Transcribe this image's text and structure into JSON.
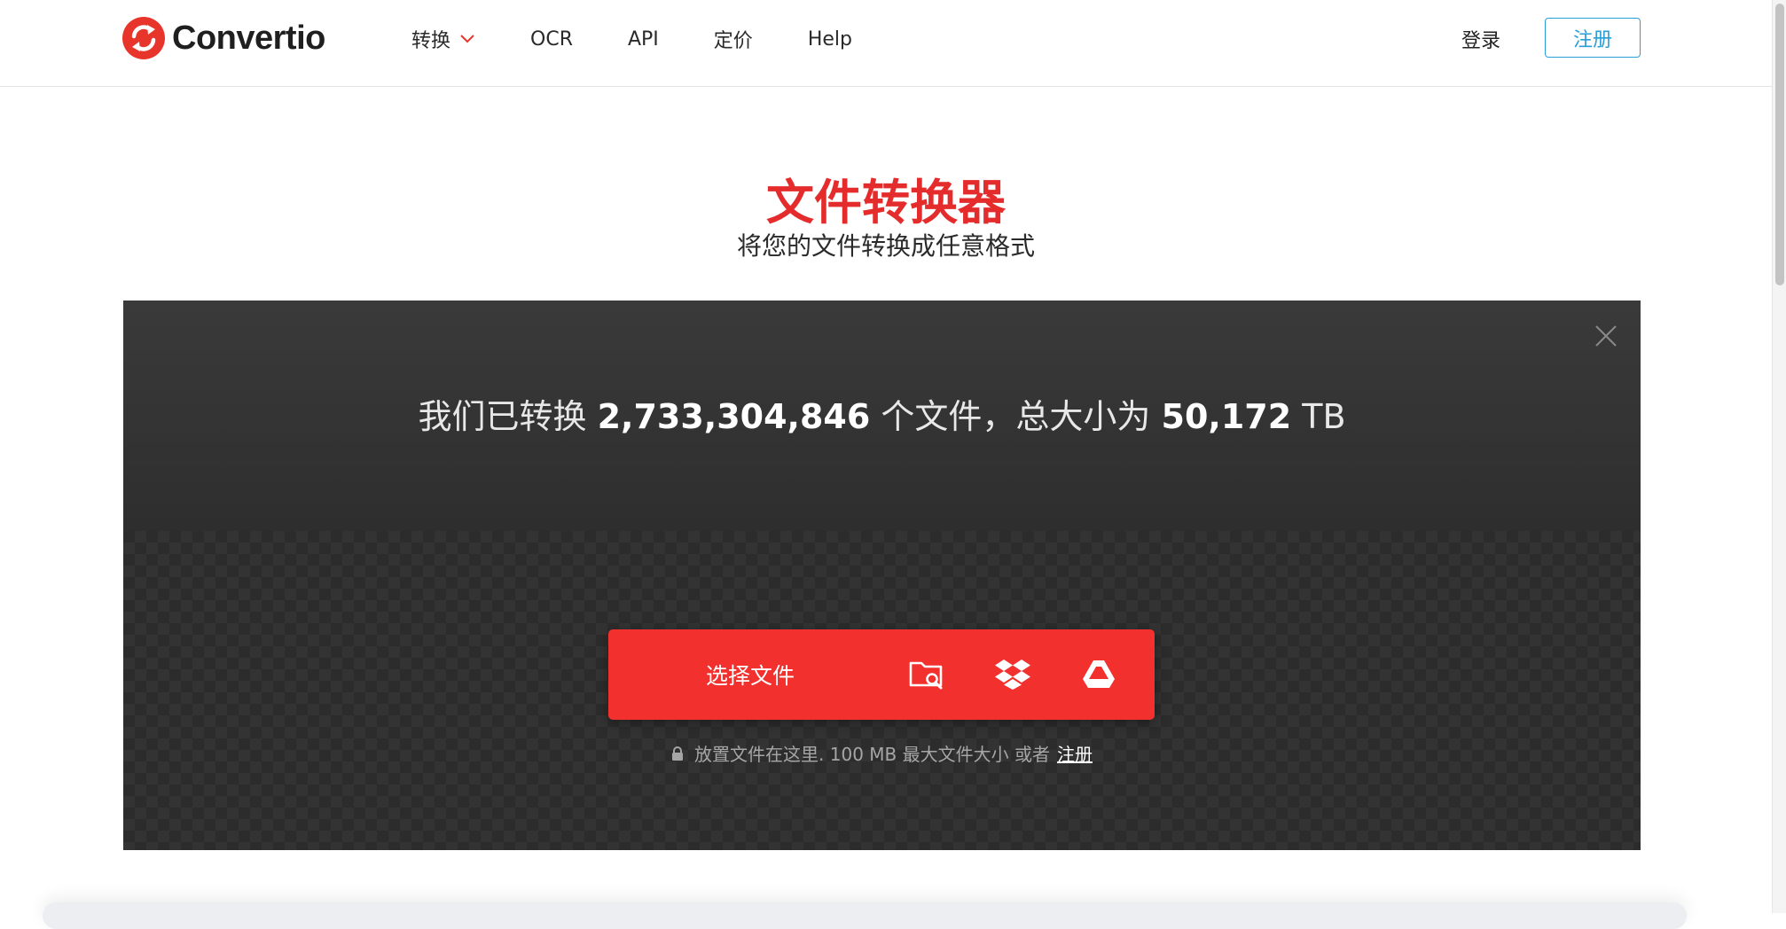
{
  "header": {
    "logo_text": "Convertio",
    "nav": [
      {
        "label": "转换",
        "has_dropdown": true
      },
      {
        "label": "OCR"
      },
      {
        "label": "API"
      },
      {
        "label": "定价"
      },
      {
        "label": "Help"
      }
    ],
    "login_label": "登录",
    "register_label": "注册"
  },
  "hero": {
    "title": "文件转换器",
    "subtitle": "将您的文件转换成任意格式"
  },
  "panel": {
    "stats_prefix": "我们已转换",
    "files_count": "2,733,304,846",
    "stats_middle": "个文件，总大小为",
    "total_size": "50,172",
    "size_unit": "TB",
    "choose_label": "选择文件",
    "sources": [
      "folder-search-icon",
      "dropbox-icon",
      "google-drive-icon"
    ],
    "drop_note": "放置文件在这里. 100 MB 最大文件大小 或者",
    "drop_link": "注册"
  },
  "colors": {
    "brand_red": "#f2302d",
    "title_red": "#e52c2c",
    "accent_blue": "#2a9fd6",
    "panel_dark": "#2c2c2c"
  }
}
